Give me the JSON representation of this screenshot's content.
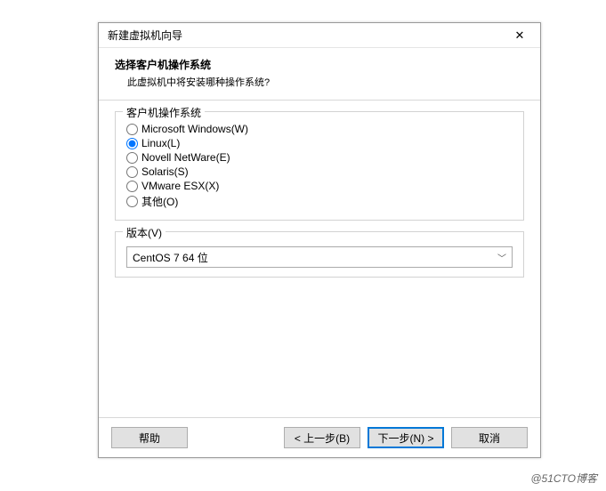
{
  "dialog": {
    "title": "新建虚拟机向导",
    "close": "✕"
  },
  "header": {
    "title": "选择客户机操作系统",
    "subtitle": "此虚拟机中将安装哪种操作系统?"
  },
  "osGroup": {
    "legend": "客户机操作系统",
    "options": [
      {
        "label": "Microsoft Windows(W)",
        "checked": false
      },
      {
        "label": "Linux(L)",
        "checked": true
      },
      {
        "label": "Novell NetWare(E)",
        "checked": false
      },
      {
        "label": "Solaris(S)",
        "checked": false
      },
      {
        "label": "VMware ESX(X)",
        "checked": false
      },
      {
        "label": "其他(O)",
        "checked": false
      }
    ]
  },
  "versionGroup": {
    "legend": "版本(V)",
    "selected": "CentOS 7 64 位"
  },
  "buttons": {
    "help": "帮助",
    "back": "< 上一步(B)",
    "next": "下一步(N) >",
    "cancel": "取消"
  },
  "watermark": "@51CTO博客"
}
